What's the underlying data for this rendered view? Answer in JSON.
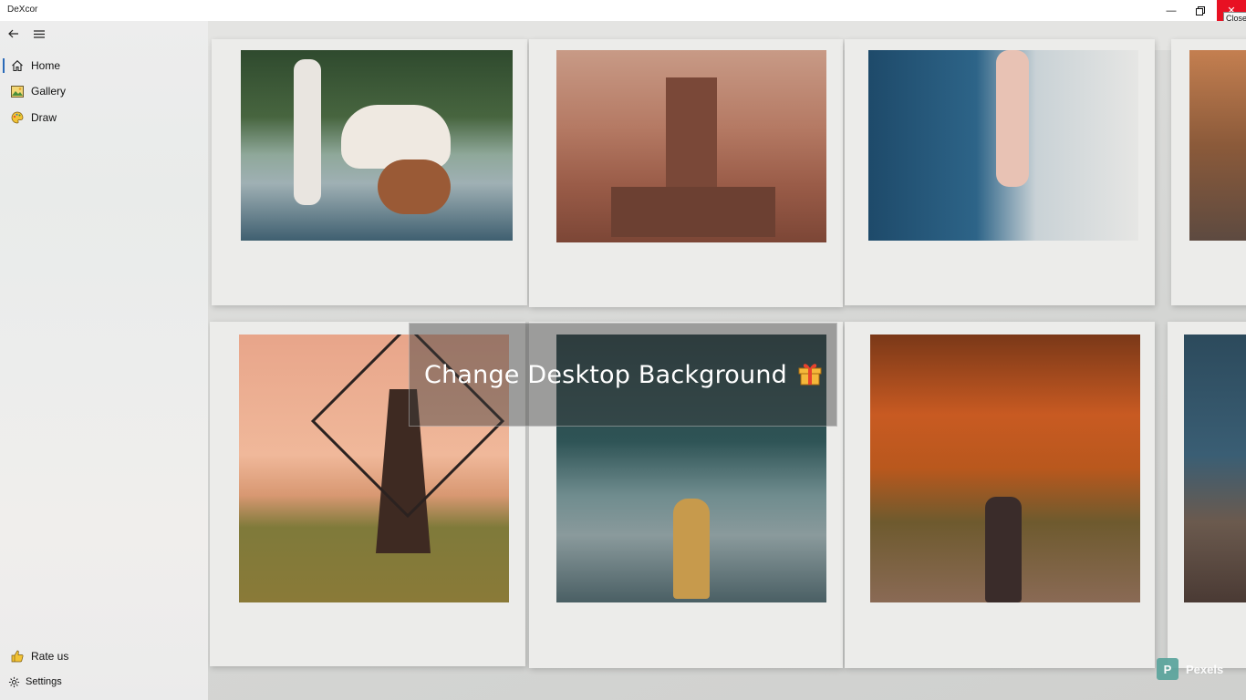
{
  "window": {
    "title": "DeXcor",
    "close_tooltip": "Close"
  },
  "sidebar": {
    "items": [
      {
        "label": "Home",
        "icon": "home-icon"
      },
      {
        "label": "Gallery",
        "icon": "gallery-icon"
      },
      {
        "label": "Draw",
        "icon": "palette-icon"
      }
    ],
    "footer": [
      {
        "label": "Rate us",
        "icon": "thumbs-up-icon"
      },
      {
        "label": "Settings",
        "icon": "gear-icon"
      }
    ]
  },
  "main": {
    "card_title": "Change Desktop Background",
    "credit": "Pexels"
  },
  "colors": {
    "accent": "#2a6ab8",
    "close": "#e81123",
    "pexels": "#5aa49c"
  }
}
